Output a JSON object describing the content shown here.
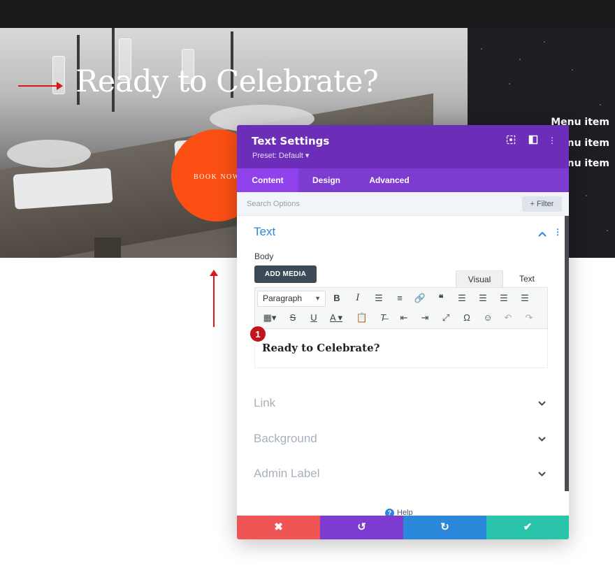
{
  "hero": {
    "title": "Ready to Celebrate?",
    "book_button": "BOOK NOW",
    "menu_items": [
      "Menu item",
      "Menu item",
      "Menu item"
    ]
  },
  "modal": {
    "title": "Text Settings",
    "preset": "Preset: Default ▾",
    "tabs": [
      "Content",
      "Design",
      "Advanced"
    ],
    "active_tab": "Content",
    "search_placeholder": "Search Options",
    "filter_label": "+ Filter",
    "text_section": {
      "heading": "Text",
      "body_label": "Body",
      "add_media": "ADD MEDIA",
      "editor_tabs": [
        "Visual",
        "Text"
      ],
      "format_select": "Paragraph",
      "content": "Ready to Celebrate?"
    },
    "closed_sections": [
      "Link",
      "Background",
      "Admin Label"
    ],
    "help_label": "Help"
  },
  "annotation": {
    "badge": "1"
  },
  "colors": {
    "header_purple": "#6c2eb9",
    "tabs_purple": "#7e3bd0",
    "accent_blue": "#2b87da",
    "book_orange": "#fb4f14",
    "annotation_red": "#d9161c",
    "cancel": "#ef5555",
    "undo": "#7e3bd0",
    "redo": "#2b87da",
    "save": "#29c4a9"
  },
  "icons": [
    "target-icon",
    "split-view-icon",
    "more-vertical-icon",
    "chevron-up-icon",
    "chevron-down-icon",
    "close-icon",
    "undo-icon",
    "redo-icon",
    "check-icon",
    "help-icon"
  ]
}
